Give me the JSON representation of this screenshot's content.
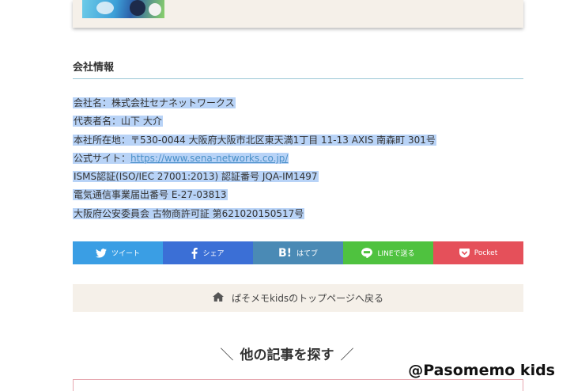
{
  "company_section": {
    "title": "会社情報",
    "lines": {
      "name": "会社名：株式会社セナネットワークス",
      "rep": "代表者名：山下 大介",
      "address": "本社所在地：〒530-0044 大阪府大阪市北区東天満1丁目 11-13 AXIS 南森町 301号",
      "site_label": "公式サイト：",
      "site_url": "https://www.sena-networks.co.jp/",
      "isms": "ISMS認証(ISO/IEC 27001:2013) 認証番号 JQA-IM1497",
      "telecom": "電気通信事業届出番号 E-27-03813",
      "antique": "大阪府公安委員会 古物商許可証 第621020150517号"
    }
  },
  "share": {
    "buttons": [
      {
        "label": "ツイート",
        "icon": "twitter-icon",
        "color": "#3a9ee4"
      },
      {
        "label": "シェア",
        "icon": "facebook-icon",
        "color": "#3b6fd6"
      },
      {
        "label": "はてブ",
        "icon": "hatena-bookmark-icon",
        "color": "#4a8ab5"
      },
      {
        "label": "LINEで送る",
        "icon": "line-icon",
        "color": "#4fc23f"
      },
      {
        "label": "Pocket",
        "icon": "pocket-icon",
        "color": "#e5505a"
      }
    ],
    "hatena_mark": "B!"
  },
  "back_link": {
    "icon": "home-icon",
    "label": "ぱそメモkidsのトップページへ戻る"
  },
  "other_articles": {
    "title": "他の記事を探す",
    "slash_left": "＼",
    "slash_right": "／"
  },
  "watermark": "@Pasomemo kids"
}
